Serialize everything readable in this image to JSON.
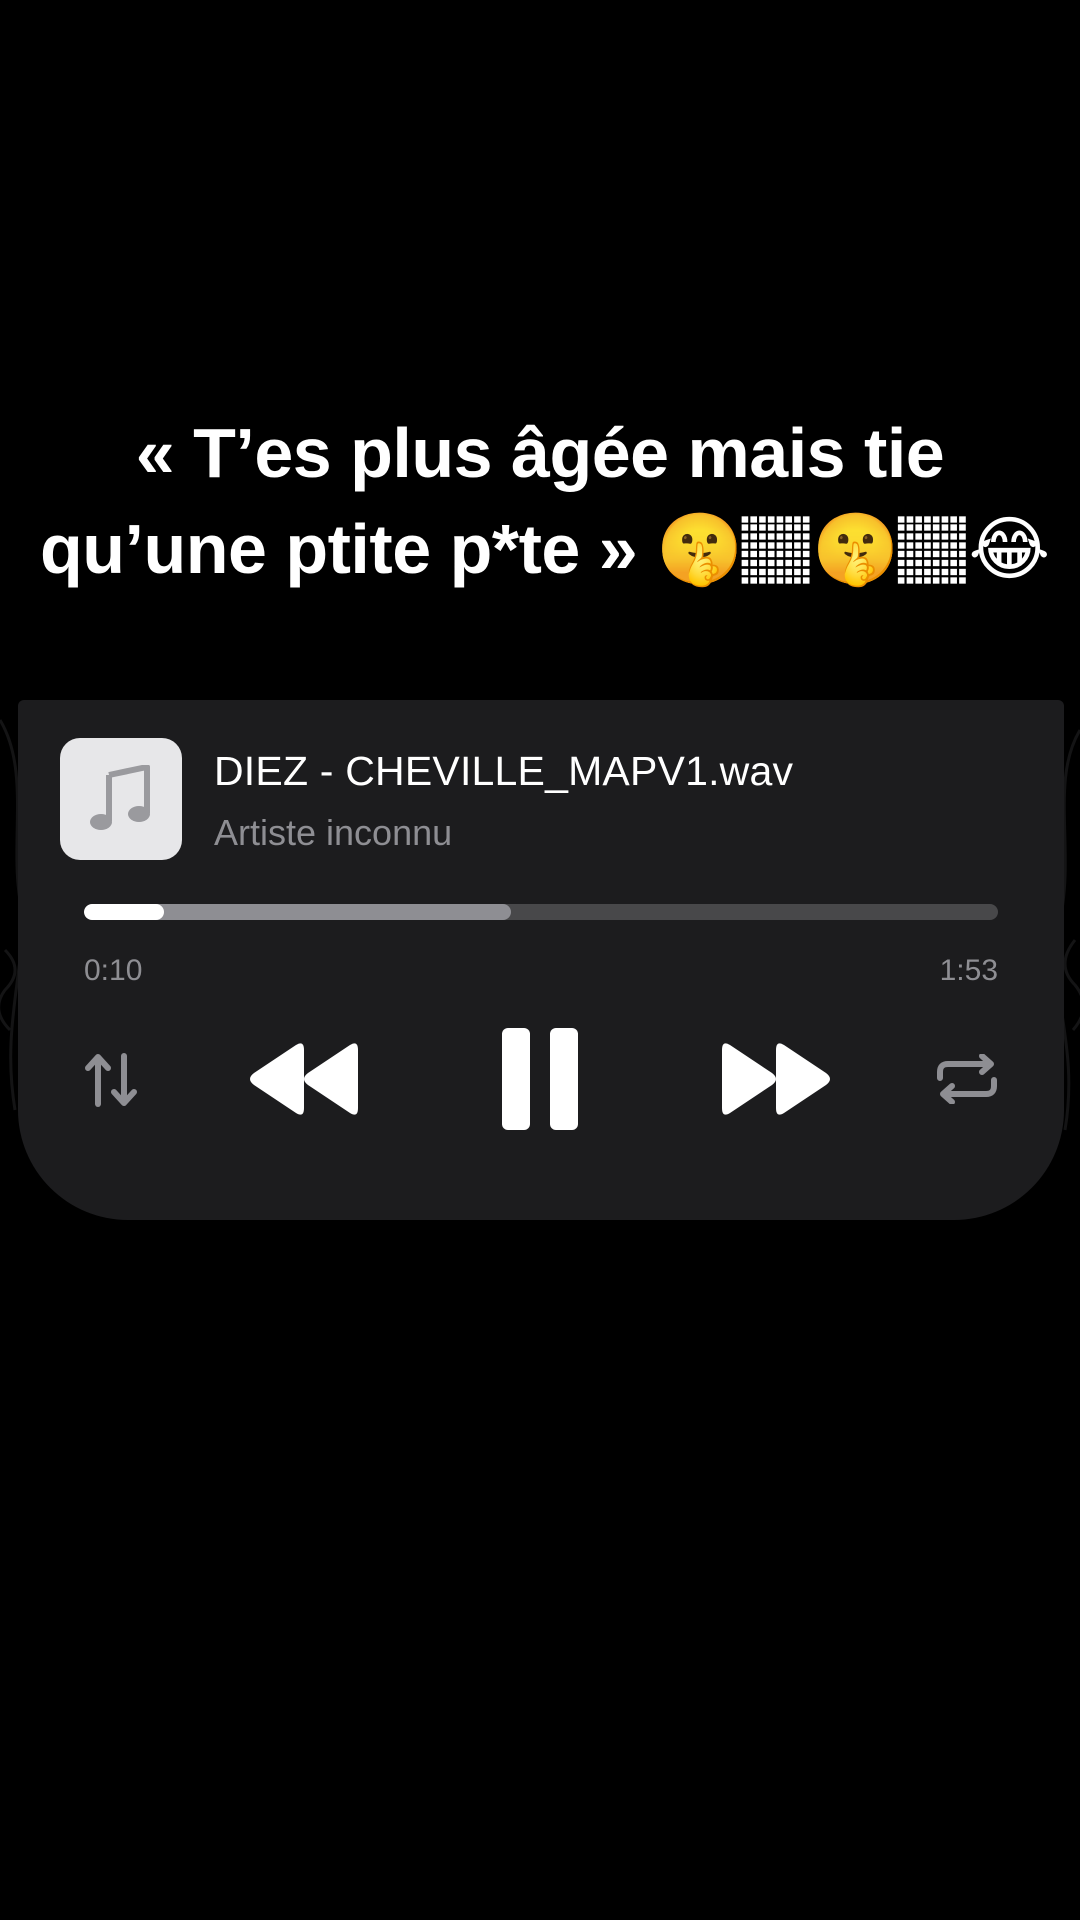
{
  "caption": {
    "line1": "« T’es plus âgée mais tie",
    "line2": "qu’une ptite p*te » 🤫🏽🤫🏽😂"
  },
  "player": {
    "track_title": "DIEZ - CHEVILLE_MAPV1.wav",
    "artist": "Artiste inconnu",
    "artwork_icon": "music-note-icon",
    "elapsed": "0:10",
    "duration": "1:53",
    "progress_fraction": 0.088,
    "buffered_fraction": 0.467,
    "controls": {
      "sort": "arrow-up-down-icon",
      "rewind": "rewind-icon",
      "pause": "pause-icon",
      "fast_forward": "fast-forward-icon",
      "repeat": "repeat-icon"
    }
  },
  "colors": {
    "background": "#000000",
    "panel": "#1c1c1e",
    "accent": "#ffffff",
    "muted": "#8e8e93"
  }
}
